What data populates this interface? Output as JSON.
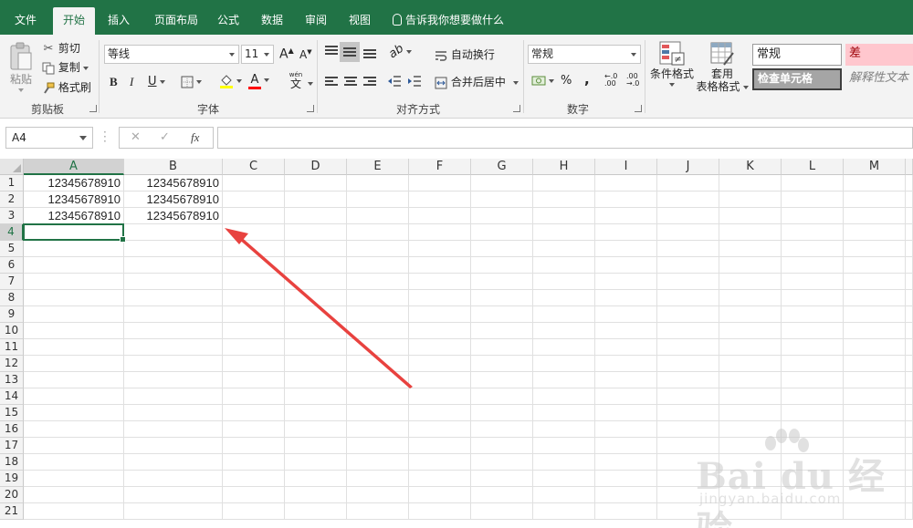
{
  "tabs": [
    {
      "label": "文件",
      "active": false
    },
    {
      "label": "开始",
      "active": true
    },
    {
      "label": "插入",
      "active": false
    },
    {
      "label": "页面布局",
      "active": false
    },
    {
      "label": "公式",
      "active": false
    },
    {
      "label": "数据",
      "active": false
    },
    {
      "label": "审阅",
      "active": false
    },
    {
      "label": "视图",
      "active": false
    }
  ],
  "tell_me": "告诉我你想要做什么",
  "ribbon": {
    "clipboard": {
      "paste": "粘贴",
      "cut": "剪切",
      "copy": "复制",
      "format_painter": "格式刷",
      "group_label": "剪贴板"
    },
    "font": {
      "font_name": "等线",
      "font_size": "11",
      "bold": "B",
      "italic": "I",
      "underline": "U",
      "grow": "A",
      "shrink": "A",
      "font_color_letter": "A",
      "phonetic": "wén",
      "phonetic_char": "文",
      "group_label": "字体"
    },
    "alignment": {
      "wrap_text": "自动换行",
      "merge_center": "合并后居中",
      "group_label": "对齐方式"
    },
    "number": {
      "format": "常规",
      "percent": "%",
      "comma": ",",
      "group_label": "数字"
    },
    "styles": {
      "conditional_format": "条件格式",
      "format_as_table_1": "套用",
      "format_as_table_2": "表格格式",
      "style_normal": "常规",
      "style_bad": "差",
      "style_check_cell": "检查单元格",
      "style_explanatory": "解释性文本"
    }
  },
  "formula_bar": {
    "name_box": "A4",
    "cancel": "✕",
    "enter": "✓",
    "fx": "fx",
    "content": ""
  },
  "sheet": {
    "columns": [
      "A",
      "B",
      "C",
      "D",
      "E",
      "F",
      "G",
      "H",
      "I",
      "J",
      "K",
      "L",
      "M"
    ],
    "rows": [
      "1",
      "2",
      "3",
      "4",
      "5",
      "6",
      "7",
      "8",
      "9",
      "10",
      "11",
      "12",
      "13",
      "14",
      "15",
      "16",
      "17",
      "18",
      "19",
      "20",
      "21"
    ],
    "cells": [
      [
        "12345678910",
        "12345678910"
      ],
      [
        "12345678910",
        "12345678910"
      ],
      [
        "12345678910",
        "12345678910"
      ]
    ],
    "active_cell": "A4"
  },
  "colors": {
    "accent": "#217346",
    "arrow": "#e8423f",
    "style_bad_bg": "#ffc7ce",
    "style_bad_text": "#9c0006"
  },
  "watermark": {
    "brand": "Bai du 经验",
    "url": "jingyan.baidu.com"
  }
}
